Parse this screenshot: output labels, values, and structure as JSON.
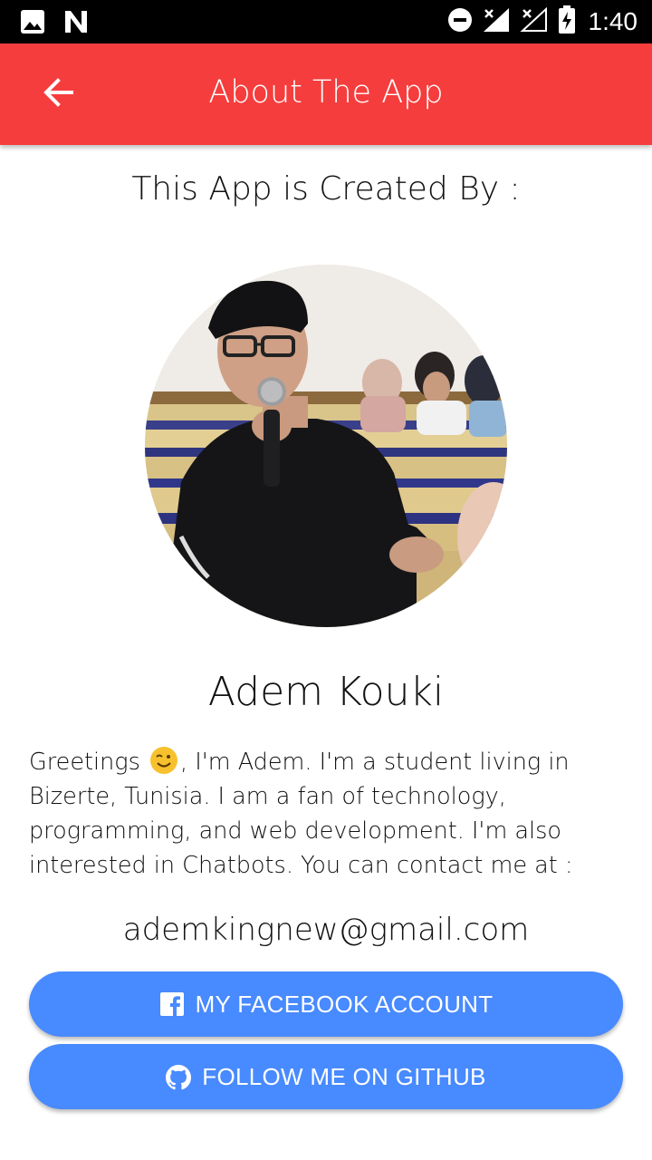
{
  "status_bar": {
    "time": "1:40",
    "icons": [
      "image-icon",
      "n-icon",
      "do-not-disturb-icon",
      "signal-x-icon",
      "signal-x-outline-icon",
      "battery-charging-icon"
    ]
  },
  "app_bar": {
    "title": "About The App",
    "back_icon": "arrow-back-icon",
    "color": "#f53d3d"
  },
  "content": {
    "created_by": "This App is Created  By :",
    "name": "Adem  Kouki",
    "bio_before_emoji": "Greetings ",
    "bio_emoji": "wink-emoji",
    "bio_after_emoji": ",  I'm Adem.  I'm a student living in  Bizerte, Tunisia.  I am a fan of technology, programming, and web development.  I'm also interested in Chatbots. You can contact me at :",
    "email": "ademkingnew@gmail.com"
  },
  "buttons": {
    "facebook": {
      "label": "MY FACEBOOK ACCOUNT",
      "icon": "facebook-icon"
    },
    "github": {
      "label": "FOLLOW ME ON GITHUB",
      "icon": "github-icon"
    },
    "color": "#488aff"
  }
}
